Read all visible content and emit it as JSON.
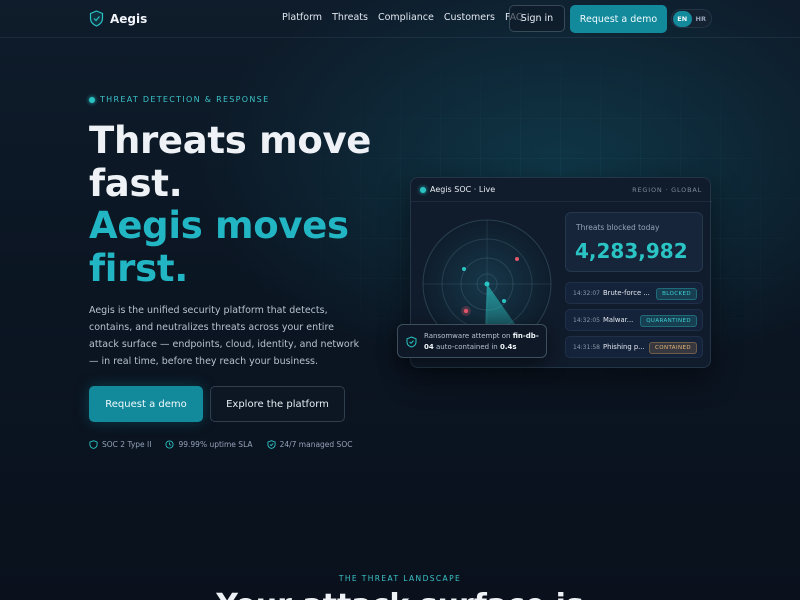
{
  "brand": {
    "name": "Aegis"
  },
  "nav": {
    "links": [
      "Platform",
      "Threats",
      "Compliance",
      "Customers",
      "FAQ"
    ],
    "signin_label": "Sign in",
    "demo_label": "Request a demo",
    "languages": [
      "EN",
      "HR"
    ],
    "active_language": "EN"
  },
  "hero": {
    "eyebrow": "THREAT DETECTION & RESPONSE",
    "headline_line1": "Threats move",
    "headline_line2": "fast.",
    "headline_accent_line1": "Aegis moves",
    "headline_accent_line2": "first.",
    "description": "Aegis is the unified security platform that detects, contains, and neutralizes threats across your entire attack surface — endpoints, cloud, identity, and network — in real time, before they reach your business.",
    "primary_cta": "Request a demo",
    "secondary_cta": "Explore the platform",
    "trust": [
      "SOC 2 Type II",
      "99.99% uptime SLA",
      "24/7 managed SOC"
    ]
  },
  "soc": {
    "title": "Aegis SOC · Live",
    "region": "REGION · GLOBAL",
    "blocked_label": "Threats blocked today",
    "blocked_value": "4,283,982",
    "events": [
      {
        "time": "14:32:07",
        "title": "Brute-force ...",
        "status": "BLOCKED",
        "tone": "teal"
      },
      {
        "time": "14:32:05",
        "title": "Malwar...",
        "status": "QUARANTINED",
        "tone": "teal"
      },
      {
        "time": "14:31:58",
        "title": "Phishing p...",
        "status": "CONTAINED",
        "tone": "amber"
      }
    ],
    "toast": {
      "prefix": "Ransomware attempt on ",
      "host": "fin-db-04",
      "middle": " auto-contained in ",
      "duration": "0.4s"
    }
  },
  "landscape": {
    "eyebrow": "THE THREAT LANDSCAPE",
    "title": "Your attack surface is"
  },
  "colors": {
    "accent": "#138a9c",
    "accent_text": "#22b6c4",
    "background": "#0b1220",
    "amber": "#e5b77a"
  },
  "icons": [
    "shield-logo-icon",
    "shield-check-icon",
    "clock-icon",
    "radar-icon"
  ]
}
